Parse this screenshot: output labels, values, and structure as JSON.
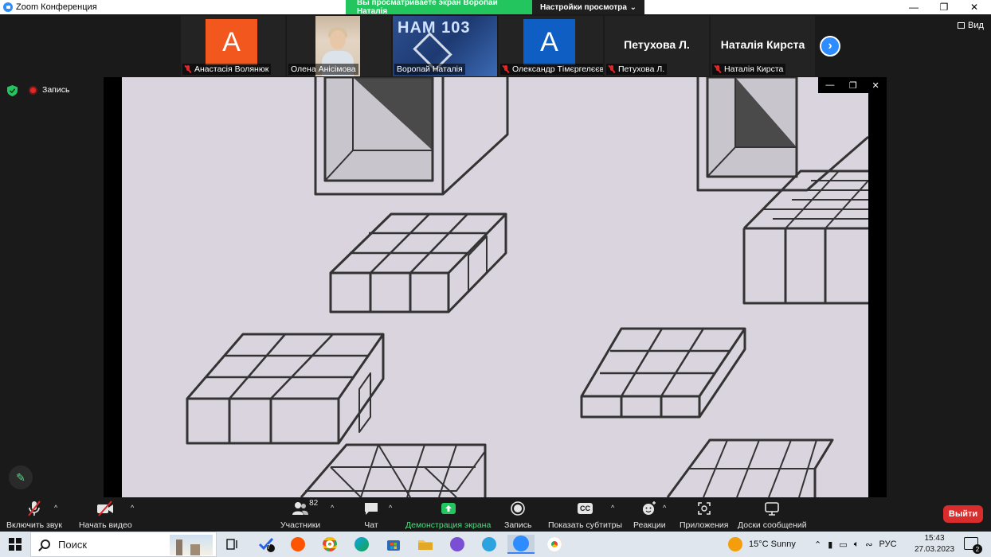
{
  "window": {
    "title": "Zoom Конференция"
  },
  "share_banner": {
    "viewing": "Вы просматриваете экран Воропай Наталія",
    "view_settings": "Настройки просмотра"
  },
  "participants": [
    {
      "name": "Анастасія Волянюк",
      "avatar_letter": "A",
      "avatar_color": "#f2581d",
      "muted": true,
      "type": "avatar"
    },
    {
      "name": "Олена Анісімова",
      "muted": false,
      "type": "video"
    },
    {
      "name": "Воропай Наталія",
      "muted": false,
      "type": "screen",
      "active": true,
      "thumb_text": "НАМ 103"
    },
    {
      "name": "Олександр Тімєргелєєв",
      "avatar_letter": "A",
      "avatar_color": "#0f5ec4",
      "muted": true,
      "type": "avatar"
    },
    {
      "name": "Петухова Л.",
      "display": "Петухова Л.",
      "muted": true,
      "type": "name"
    },
    {
      "name": "Наталія Кирста",
      "display": "Наталія Кирста",
      "muted": true,
      "type": "name"
    }
  ],
  "view_label": "Вид",
  "recording_label": "Запись",
  "toolbar": {
    "unmute": "Включить звук",
    "start_video": "Начать видео",
    "participants": "Участники",
    "participants_count": "82",
    "chat": "Чат",
    "share_screen": "Демонстрация экрана",
    "record": "Запись",
    "captions": "Показать субтитры",
    "captions_icon": "CC",
    "reactions": "Реакции",
    "apps": "Приложения",
    "whiteboards": "Доски сообщений",
    "leave": "Выйти"
  },
  "taskbar": {
    "search_placeholder": "Поиск",
    "badge_count": "7",
    "weather": "15°C  Sunny",
    "language": "РУС",
    "time": "15:43",
    "date": "27.03.2023",
    "notifications": "2"
  }
}
